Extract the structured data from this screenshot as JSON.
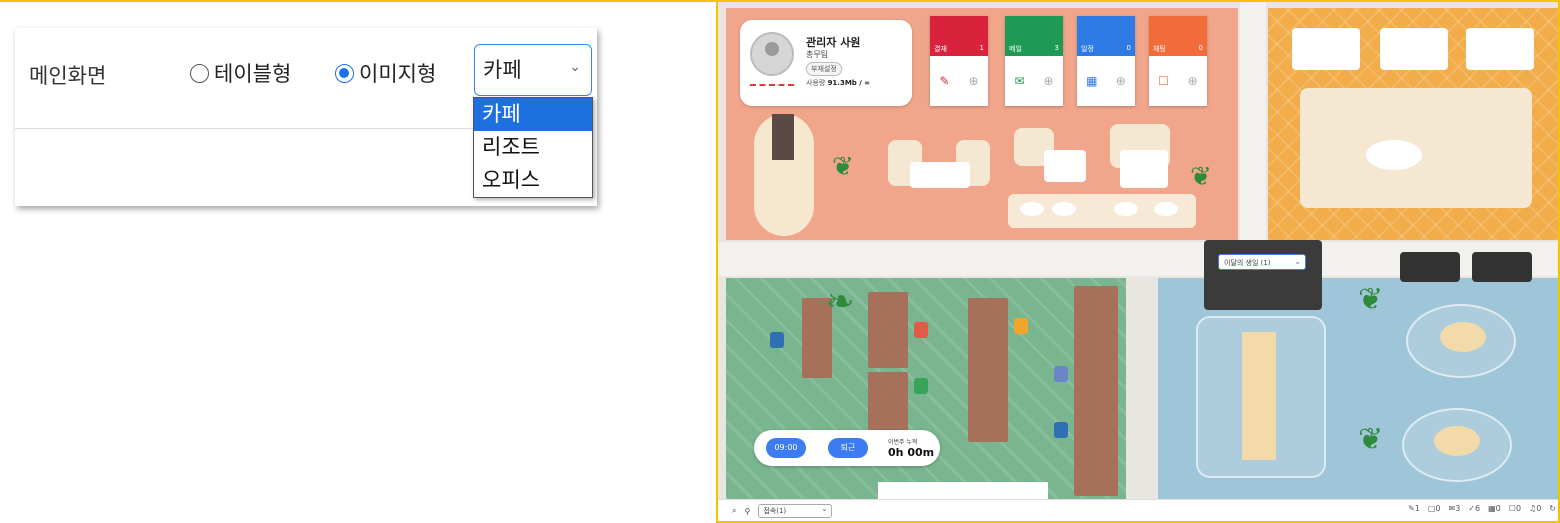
{
  "settings": {
    "label": "메인화면",
    "radio_table_label": "테이블형",
    "radio_image_label": "이미지형",
    "select_value": "카페",
    "options": [
      "카페",
      "리조트",
      "오피스"
    ]
  },
  "map": {
    "profile": {
      "name": "관리자 사원",
      "team": "총무팀",
      "settings_button": "부재설정",
      "usage_label": "사용량",
      "usage_value": "91.3Mb / ∞"
    },
    "cards": [
      {
        "label": "결재",
        "count": "1",
        "color": "#d9233c"
      },
      {
        "label": "메일",
        "count": "3",
        "color": "#1f9a55"
      },
      {
        "label": "일정",
        "count": "0",
        "color": "#2f7be6"
      },
      {
        "label": "채팅",
        "count": "0",
        "color": "#f26b3a"
      }
    ],
    "attendance": {
      "check_in": "09:00",
      "check_out": "퇴근",
      "week_label": "이번주 누적",
      "week_value": "0h 00m"
    },
    "meeting_screen_select": "이달의 생일 (1)",
    "toolbar": {
      "connect_select": "접속(1)",
      "counts": [
        "1",
        "0",
        "3",
        "6",
        "0",
        "0",
        "0"
      ]
    }
  }
}
